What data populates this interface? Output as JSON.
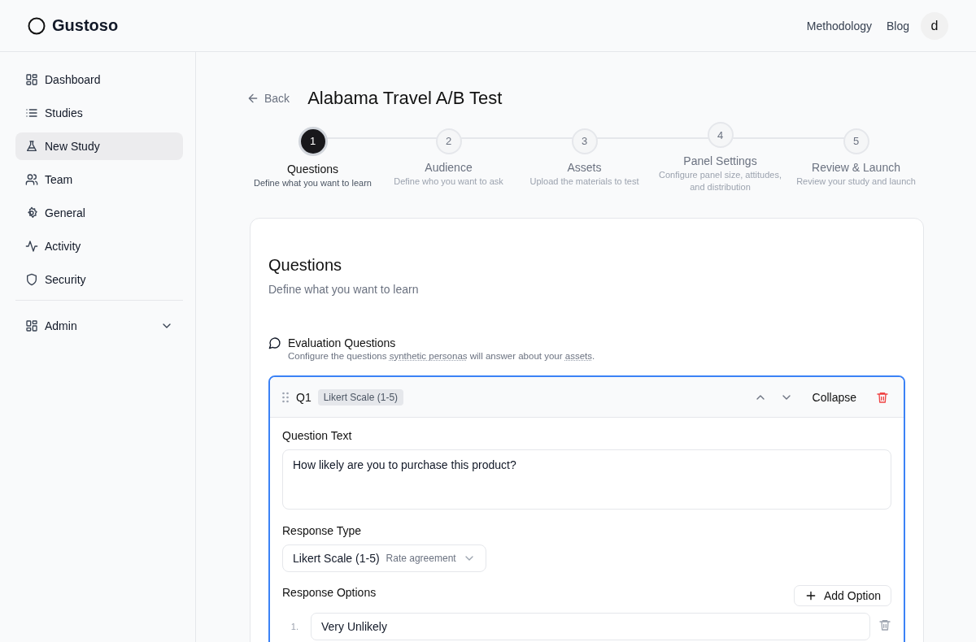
{
  "header": {
    "logo": "Gustoso",
    "nav": [
      "Methodology",
      "Blog"
    ],
    "avatar": "d"
  },
  "sidebar": {
    "items": [
      {
        "label": "Dashboard",
        "selected": false
      },
      {
        "label": "Studies",
        "selected": false
      },
      {
        "label": "New Study",
        "selected": true
      },
      {
        "label": "Team",
        "selected": false
      },
      {
        "label": "General",
        "selected": false
      },
      {
        "label": "Activity",
        "selected": false
      },
      {
        "label": "Security",
        "selected": false
      }
    ],
    "admin": {
      "label": "Admin",
      "expanded": false
    }
  },
  "page": {
    "back": "Back",
    "title": "Alabama Travel A/B Test"
  },
  "steps": [
    {
      "number": "1",
      "title": "Questions",
      "description": "Define what you want to learn",
      "selected": true
    },
    {
      "number": "2",
      "title": "Audience",
      "description": "Define who you want to ask",
      "selected": false
    },
    {
      "number": "3",
      "title": "Assets",
      "description": "Upload the materials to test",
      "selected": false
    },
    {
      "number": "4",
      "title": "Panel Settings",
      "description": "Configure panel size, attitudes, and distribution",
      "selected": false
    },
    {
      "number": "5",
      "title": "Review & Launch",
      "description": "Review your study and launch",
      "selected": false
    }
  ],
  "section": {
    "title": "Questions",
    "subtitle": "Define what you want to learn",
    "group": {
      "title": "Evaluation Questions",
      "description": [
        {
          "kind": "text",
          "text": "Configure the questions "
        },
        {
          "kind": "term",
          "text": "synthetic personas"
        },
        {
          "kind": "text",
          "text": " will answer about your "
        },
        {
          "kind": "term",
          "text": "assets"
        },
        {
          "kind": "text",
          "text": "."
        }
      ]
    }
  },
  "question": {
    "number": "Q1",
    "type_badge": "Likert Scale (1-5)",
    "expanded": true,
    "collapse": "Collapse",
    "question_text_label": "Question Text",
    "question_text": "How likely are you to purchase this product?",
    "response_type_label": "Response Type",
    "response_type": "Likert Scale (1-5)",
    "response_type_hint": "Rate agreement",
    "response_options_label": "Response Options",
    "add_option": "Add Option",
    "options": [
      {
        "index": "1.",
        "value": "Very Unlikely"
      }
    ]
  }
}
